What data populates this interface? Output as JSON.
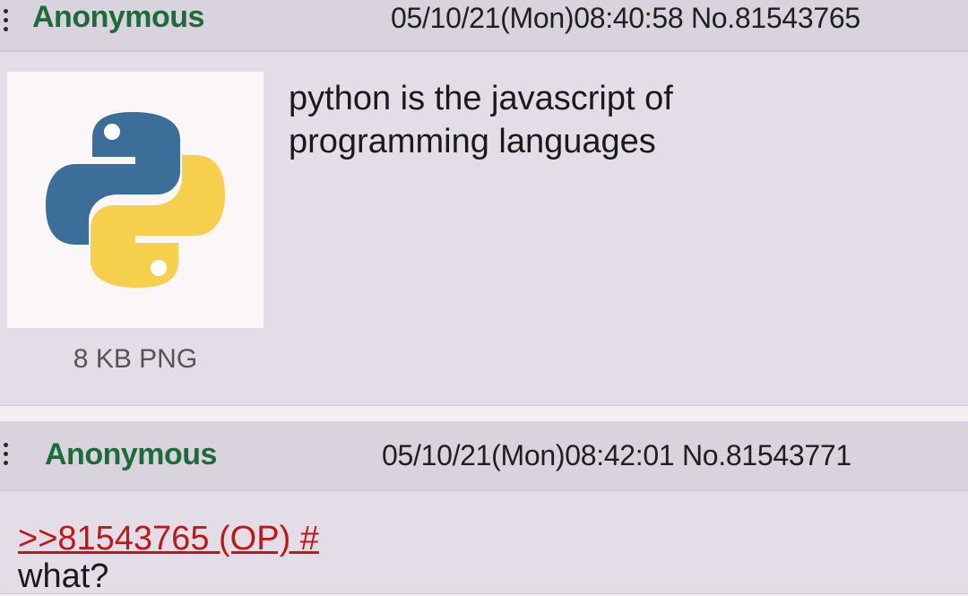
{
  "posts": [
    {
      "name": "Anonymous",
      "datetime": "05/10/21(Mon)08:40:58",
      "number": "No.81543765",
      "file_info": "8 KB PNG",
      "thumbnail_icon": "python-logo-icon",
      "body": "python is the javascript of\nprogramming languages"
    },
    {
      "name": "Anonymous",
      "datetime": "05/10/21(Mon)08:42:01",
      "number": "No.81543771",
      "quote_link": ">>81543765 (OP) #",
      "body": "what?"
    }
  ],
  "colors": {
    "name": "#1e6b3a",
    "quote_link": "#c01818",
    "python_blue": "#3b6e99",
    "python_yellow": "#f6d04d"
  }
}
